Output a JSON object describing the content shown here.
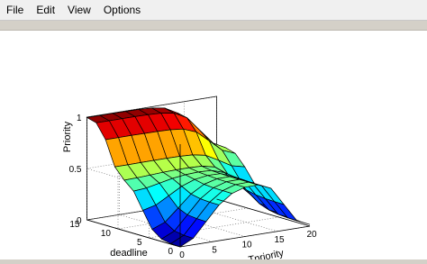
{
  "menu": {
    "items": [
      "File",
      "Edit",
      "View",
      "Options"
    ]
  },
  "chart_data": {
    "type": "surface",
    "title": "",
    "xlabel": "Tpriority",
    "ylabel": "deadline",
    "zlabel": "Priority",
    "x_ticks": [
      0,
      5,
      10,
      15,
      20
    ],
    "y_ticks": [
      0,
      5,
      10,
      15
    ],
    "z_ticks": [
      0,
      0.5,
      1
    ],
    "xlim": [
      0,
      20
    ],
    "ylim": [
      0,
      15
    ],
    "zlim": [
      0,
      1
    ],
    "colormap": "jet",
    "grid": true,
    "surface_description_values": {
      "x": [
        0,
        2,
        4,
        6,
        8,
        10,
        12,
        14,
        16,
        18,
        20
      ],
      "y": [
        0,
        1.5,
        3,
        4.5,
        6,
        7.5,
        9,
        10.5,
        12,
        13.5,
        15
      ],
      "high_deadline_plateau_z": 1.0,
      "mid_plateau_z": 0.5,
      "low_corner_z": 0.0
    }
  }
}
